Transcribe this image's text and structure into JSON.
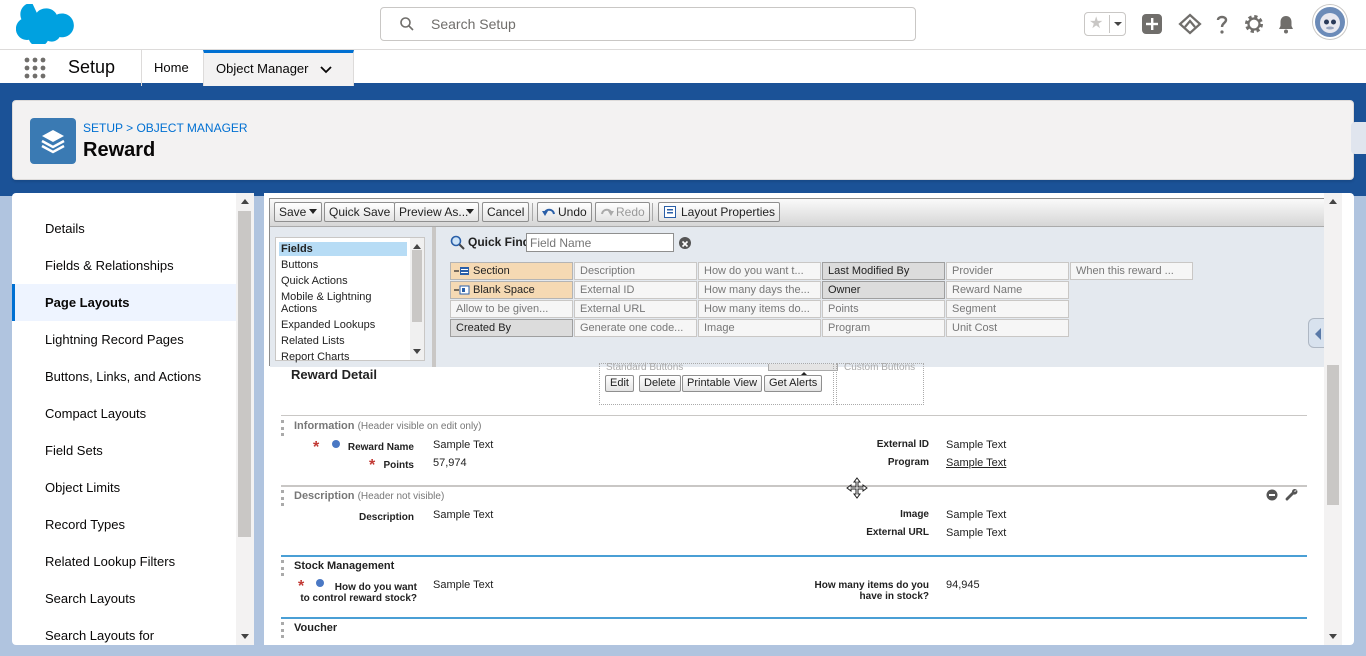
{
  "header": {
    "search_placeholder": "Search Setup"
  },
  "context": {
    "app_name": "Setup",
    "tabs": [
      {
        "label": "Home"
      },
      {
        "label": "Object Manager"
      }
    ]
  },
  "page": {
    "breadcrumb": "SETUP > OBJECT MANAGER",
    "title": "Reward",
    "accent": "#1b5297"
  },
  "sidebar": {
    "items": [
      {
        "label": "Details"
      },
      {
        "label": "Fields & Relationships"
      },
      {
        "label": "Page Layouts"
      },
      {
        "label": "Lightning Record Pages"
      },
      {
        "label": "Buttons, Links, and Actions"
      },
      {
        "label": "Compact Layouts"
      },
      {
        "label": "Field Sets"
      },
      {
        "label": "Object Limits"
      },
      {
        "label": "Record Types"
      },
      {
        "label": "Related Lookup Filters"
      },
      {
        "label": "Search Layouts"
      },
      {
        "label": "Search Layouts for"
      }
    ],
    "active_index": 2
  },
  "toolbar": {
    "save": "Save",
    "quick_save": "Quick Save",
    "preview_as": "Preview As...",
    "cancel": "Cancel",
    "undo": "Undo",
    "redo": "Redo",
    "layout_properties": "Layout Properties"
  },
  "palette": {
    "categories": [
      "Fields",
      "Buttons",
      "Quick Actions",
      "Mobile & Lightning",
      "Actions",
      "Expanded Lookups",
      "Related Lists",
      "Report Charts"
    ],
    "quick_find_label": "Quick Find",
    "quick_find_placeholder": "Field Name",
    "items": [
      [
        "Section",
        "Blank Space",
        "Allow to be given...",
        "Created By"
      ],
      [
        "Description",
        "External ID",
        "External URL",
        "Generate one code..."
      ],
      [
        "How do you want t...",
        "How many days the...",
        "How many items do...",
        "Image"
      ],
      [
        "Last Modified By",
        "Owner",
        "Points",
        "Program"
      ],
      [
        "Provider",
        "Reward Name",
        "Segment",
        "Unit Cost"
      ],
      [
        "When this reward ..."
      ]
    ]
  },
  "layout": {
    "detail_title": "Reward Detail",
    "standard_buttons_label": "Standard Buttons",
    "custom_buttons_label": "Custom Buttons",
    "standard_buttons": [
      "Edit",
      "Delete",
      "Printable View",
      "Get Alerts"
    ],
    "sections": {
      "information": {
        "title": "Information",
        "note": "(Header visible on edit only)",
        "left": [
          {
            "label": "Reward Name",
            "value": "Sample Text"
          },
          {
            "label": "Points",
            "value": "57,974"
          }
        ],
        "right": [
          {
            "label": "External ID",
            "value": "Sample Text"
          },
          {
            "label": "Program",
            "value": "Sample Text"
          }
        ]
      },
      "description": {
        "title": "Description",
        "note": "(Header not visible)",
        "left": [
          {
            "label": "Description",
            "value": "Sample Text"
          }
        ],
        "right": [
          {
            "label": "Image",
            "value": "Sample Text"
          },
          {
            "label": "External URL",
            "value": "Sample Text"
          }
        ]
      },
      "stock": {
        "title": "Stock Management",
        "left": [
          {
            "label": "How do you want",
            "label2": "to control reward stock?",
            "value": "Sample Text"
          }
        ],
        "right": [
          {
            "label": "How many items do you",
            "label2": "have in stock?",
            "value": "94,945"
          }
        ]
      },
      "voucher": {
        "title": "Voucher"
      }
    }
  }
}
